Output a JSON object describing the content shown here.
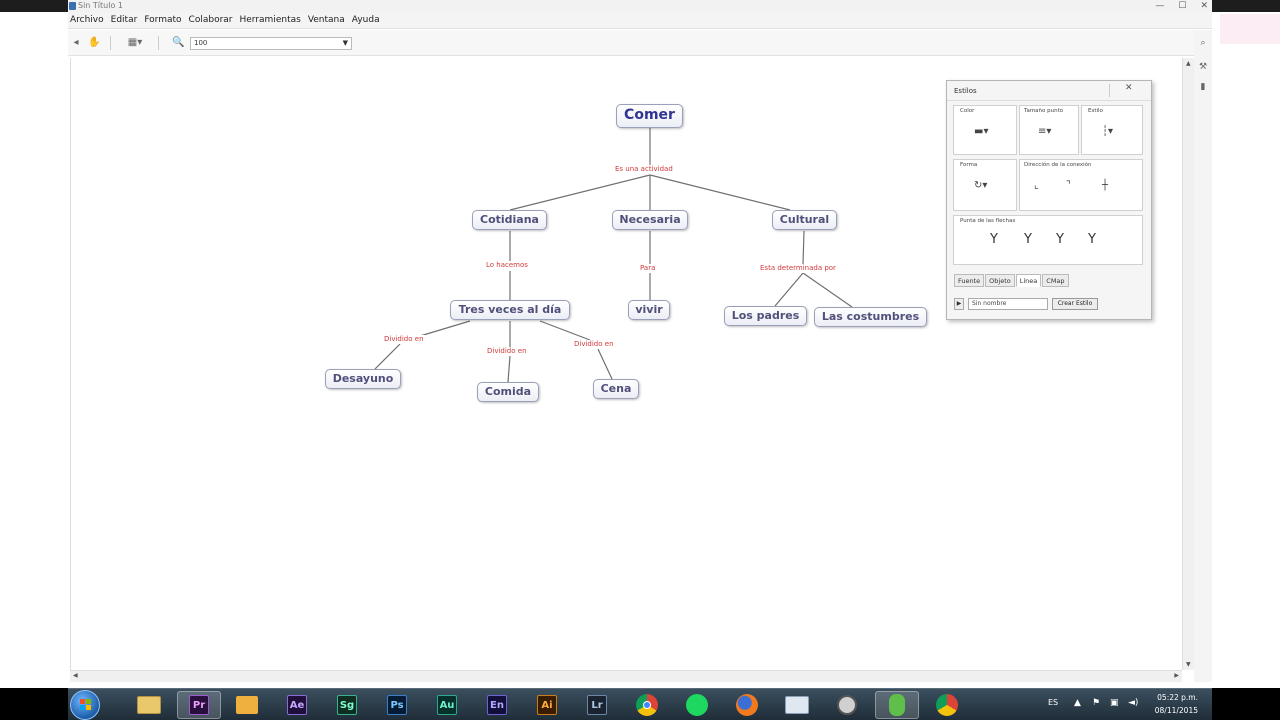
{
  "window": {
    "title": "Sin Título 1"
  },
  "menu": [
    "Archivo",
    "Editar",
    "Formato",
    "Colaborar",
    "Herramientas",
    "Ventana",
    "Ayuda"
  ],
  "toolbar": {
    "zoom": "100"
  },
  "map": {
    "concepts": {
      "comer": "Comer",
      "cotidiana": "Cotidiana",
      "necesaria": "Necesaria",
      "cultural": "Cultural",
      "tres": "Tres veces al día",
      "vivir": "vivir",
      "padres": "Los padres",
      "costumbres": "Las costumbres",
      "desayuno": "Desayuno",
      "comida": "Comida",
      "cena": "Cena"
    },
    "links": {
      "es_una": "Es una actividad",
      "lo_hacemos": "Lo hacemos",
      "para": "Para",
      "esta": "Esta determinada por",
      "div1": "Dividido en",
      "div2": "Dividido en",
      "div3": "Dividido en"
    }
  },
  "styles_panel": {
    "title": "Estilos",
    "close": "✕",
    "color": "Color",
    "thickness": "Tamaño punto",
    "style": "Estilo",
    "shape": "Forma",
    "direction": "Dirección de la conexión",
    "arrowheads": "Punta de las flechas",
    "tabs": [
      "Fuente",
      "Objeto",
      "Línea",
      "CMap"
    ],
    "style_name": "Sin nombre",
    "create_button": "Crear Estilo"
  },
  "taskbar": {
    "apps": [
      "explorer",
      "Pr",
      "media",
      "Ae",
      "Sg",
      "Ps",
      "Au",
      "En",
      "Ai",
      "Lr",
      "chrome",
      "spotify",
      "firefox",
      "window",
      "tool",
      "cmaptools",
      "chrome2"
    ],
    "lang": "ES",
    "time": "05:22 p.m.",
    "date": "08/11/2015"
  },
  "colors": {
    "concept_text": "#50507a",
    "root_text": "#2f3590",
    "link_label": "#d23a3a"
  }
}
